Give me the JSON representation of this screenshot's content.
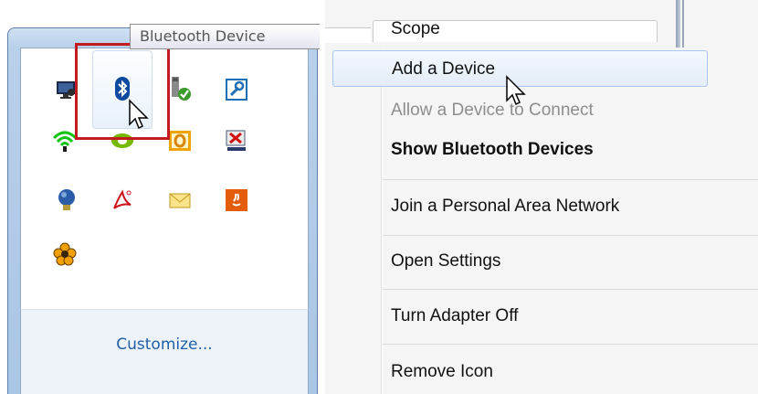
{
  "tray": {
    "tooltip": "Bluetooth Device",
    "customize_label": "Customize...",
    "icons": [
      "network-monitor-icon",
      "bluetooth-icon",
      "safely-remove-hardware-icon",
      "app-wrench-icon",
      "wireless-signal-icon",
      "nvidia-icon",
      "outlook-icon",
      "network-disconnected-icon",
      "light-bulb-icon",
      "adobe-reader-icon",
      "mail-icon",
      "java-icon",
      "flower-app-icon"
    ],
    "highlight_color": "#c31a1f"
  },
  "menu": {
    "header_tab": "Scope",
    "items": [
      {
        "label": "Add a Device",
        "state": "hovered"
      },
      {
        "label": "Allow a Device to Connect",
        "state": "disabled"
      },
      {
        "label": "Show Bluetooth Devices",
        "state": "default"
      },
      {
        "label": "Join a Personal Area Network",
        "state": "normal"
      },
      {
        "label": "Open Settings",
        "state": "normal"
      },
      {
        "label": "Turn Adapter Off",
        "state": "normal"
      },
      {
        "label": "Remove Icon",
        "state": "normal"
      }
    ],
    "hover_color": "#a8c7ea"
  }
}
